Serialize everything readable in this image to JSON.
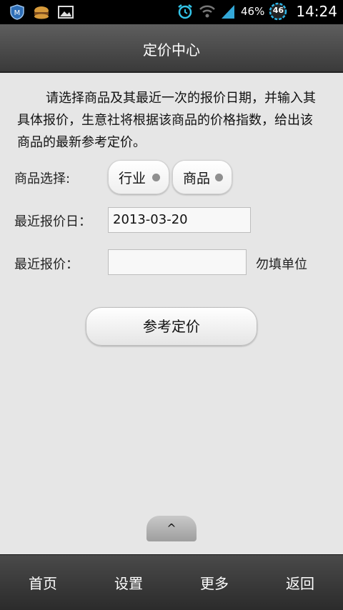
{
  "status_bar": {
    "battery_percent": "46%",
    "badge": "46",
    "time": "14:24"
  },
  "header": {
    "title": "定价中心"
  },
  "intro": {
    "text": "请选择商品及其最近一次的报价日期，并输入其具体报价，生意社将根据该商品的价格指数，给出该商品的最新参考定价。"
  },
  "form": {
    "product_select_label": "商品选择:",
    "industry_option": "行业",
    "product_option": "商品",
    "last_date_label": "最近报价日：",
    "last_date_value": "2013-03-20",
    "last_price_label": "最近报价：",
    "last_price_value": "",
    "unit_hint": "勿填单位",
    "submit_label": "参考定价"
  },
  "up_tab": {
    "label": "^"
  },
  "nav": {
    "items": [
      {
        "label": "首页"
      },
      {
        "label": "设置"
      },
      {
        "label": "更多"
      },
      {
        "label": "返回"
      }
    ]
  }
}
